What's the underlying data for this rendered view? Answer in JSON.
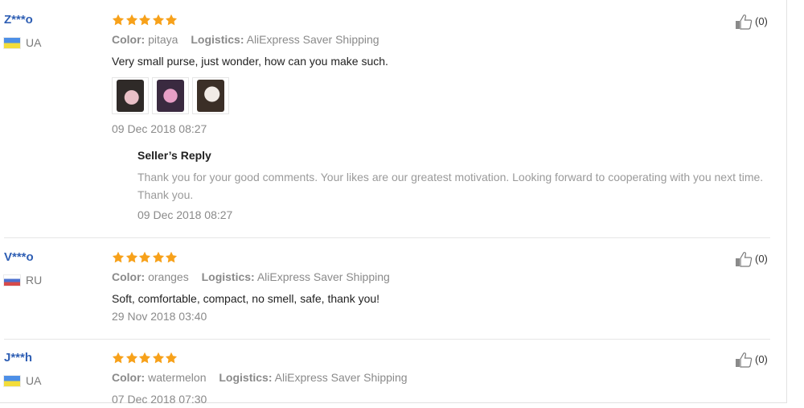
{
  "reviews": [
    {
      "user": "Z***o",
      "country": "UA",
      "flag": "ua",
      "color_label": "Color:",
      "color_value": "pitaya",
      "logistics_label": "Logistics:",
      "logistics_value": "AliExpress Saver Shipping",
      "comment": "Very small purse, just wonder, how can you make such.",
      "date": "09 Dec 2018 08:27",
      "likes": "(0)",
      "stars": 5,
      "reply_title": "Seller’s Reply",
      "reply_text": "Thank you for your good comments. Your likes are our greatest motivation. Looking forward to cooperating with you next time. Thank you.",
      "reply_date": "09 Dec 2018 08:27"
    },
    {
      "user": "V***o",
      "country": "RU",
      "flag": "ru",
      "color_label": "Color:",
      "color_value": "oranges",
      "logistics_label": "Logistics:",
      "logistics_value": "AliExpress Saver Shipping",
      "comment": "Soft, comfortable, compact, no smell, safe, thank you!",
      "date": "29 Nov 2018 03:40",
      "likes": "(0)",
      "stars": 5
    },
    {
      "user": "J***h",
      "country": "UA",
      "flag": "ua",
      "color_label": "Color:",
      "color_value": "watermelon",
      "logistics_label": "Logistics:",
      "logistics_value": "AliExpress Saver Shipping",
      "date": "07 Dec 2018 07:30",
      "likes": "(0)",
      "stars": 5
    }
  ],
  "icons": {
    "star": "star-icon",
    "like": "thumbs-up-icon"
  },
  "colors": {
    "star": "#f7a11a",
    "username": "#2f5fb4",
    "meta": "#8a8a8a"
  }
}
